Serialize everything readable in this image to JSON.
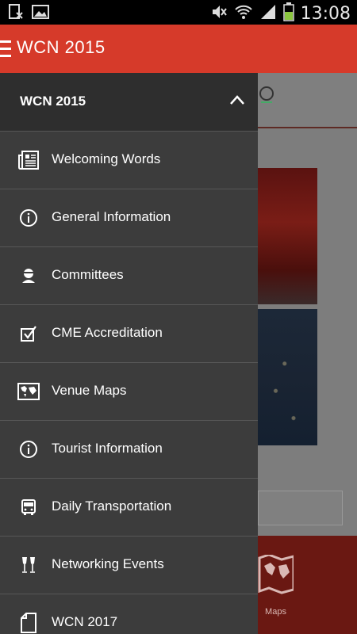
{
  "status_bar": {
    "time": "13:08"
  },
  "app_bar": {
    "title": "WCN 2015"
  },
  "drawer": {
    "section_title": "WCN 2015",
    "items": [
      {
        "label": "Welcoming Words",
        "icon": "newspaper-icon"
      },
      {
        "label": "General Information",
        "icon": "info-icon"
      },
      {
        "label": "Committees",
        "icon": "person-icon"
      },
      {
        "label": "CME Accreditation",
        "icon": "checkbox-icon"
      },
      {
        "label": "Venue Maps",
        "icon": "world-map-icon"
      },
      {
        "label": "Tourist Information",
        "icon": "info-icon"
      },
      {
        "label": "Daily Transportation",
        "icon": "bus-icon"
      },
      {
        "label": "Networking Events",
        "icon": "glasses-toast-icon"
      },
      {
        "label": "WCN 2017",
        "icon": "document-icon"
      }
    ]
  },
  "background": {
    "bottom_tile_label": "Maps"
  },
  "colors": {
    "accent": "#d63a2a",
    "drawer_bg": "#3c3c3c",
    "drawer_header_bg": "#2e2e2e"
  }
}
